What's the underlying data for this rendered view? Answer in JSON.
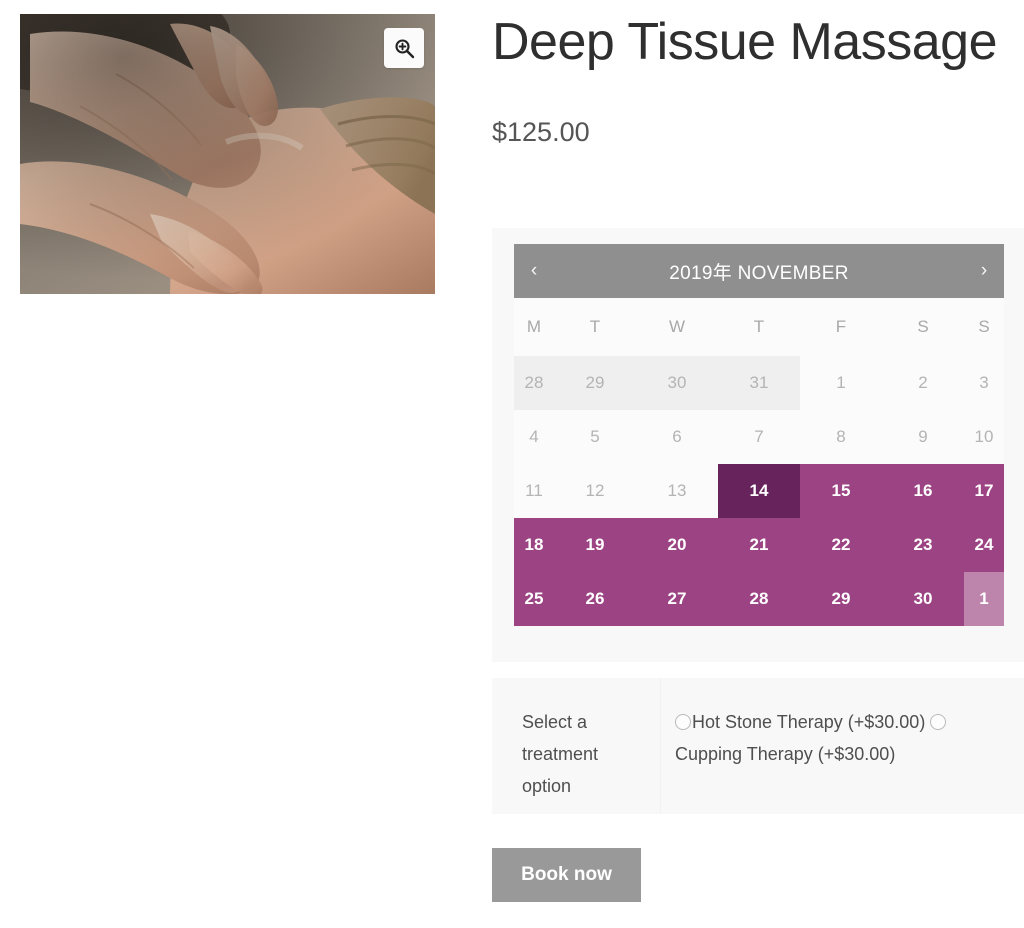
{
  "product": {
    "title": "Deep Tissue Massage",
    "price": "$125.00",
    "image_alt": "massage-therapy-hands-on-shoulder",
    "zoom_icon": "zoom-in-icon"
  },
  "calendar": {
    "prev_label": "‹",
    "next_label": "›",
    "title": "2019年 NOVEMBER",
    "weekdays": [
      "M",
      "T",
      "W",
      "T",
      "F",
      "S",
      "S"
    ],
    "weeks": [
      [
        {
          "day": "28",
          "state": "other-month"
        },
        {
          "day": "29",
          "state": "other-month"
        },
        {
          "day": "30",
          "state": "other-month"
        },
        {
          "day": "31",
          "state": "other-month"
        },
        {
          "day": "1",
          "state": "unavailable"
        },
        {
          "day": "2",
          "state": "unavailable"
        },
        {
          "day": "3",
          "state": "unavailable"
        }
      ],
      [
        {
          "day": "4",
          "state": "unavailable"
        },
        {
          "day": "5",
          "state": "unavailable"
        },
        {
          "day": "6",
          "state": "unavailable"
        },
        {
          "day": "7",
          "state": "unavailable"
        },
        {
          "day": "8",
          "state": "unavailable"
        },
        {
          "day": "9",
          "state": "unavailable"
        },
        {
          "day": "10",
          "state": "unavailable"
        }
      ],
      [
        {
          "day": "11",
          "state": "unavailable"
        },
        {
          "day": "12",
          "state": "unavailable"
        },
        {
          "day": "13",
          "state": "unavailable"
        },
        {
          "day": "14",
          "state": "selected"
        },
        {
          "day": "15",
          "state": "available"
        },
        {
          "day": "16",
          "state": "available"
        },
        {
          "day": "17",
          "state": "available"
        }
      ],
      [
        {
          "day": "18",
          "state": "available"
        },
        {
          "day": "19",
          "state": "available"
        },
        {
          "day": "20",
          "state": "available"
        },
        {
          "day": "21",
          "state": "available"
        },
        {
          "day": "22",
          "state": "available"
        },
        {
          "day": "23",
          "state": "available"
        },
        {
          "day": "24",
          "state": "available"
        }
      ],
      [
        {
          "day": "25",
          "state": "available"
        },
        {
          "day": "26",
          "state": "available"
        },
        {
          "day": "27",
          "state": "available"
        },
        {
          "day": "28",
          "state": "available"
        },
        {
          "day": "29",
          "state": "available"
        },
        {
          "day": "30",
          "state": "available"
        },
        {
          "day": "1",
          "state": "next-month-available"
        }
      ]
    ],
    "colors": {
      "header_bar": "#8f8f8f",
      "available": "#9c4384",
      "selected": "#67245c",
      "next_month_available": "#bd85ab",
      "other_month": "#efefef",
      "panel_background": "#f8f8f8"
    }
  },
  "options": {
    "label": "Select a treatment option",
    "items": [
      {
        "label": "Hot Stone Therapy (+$30.00)",
        "selected": false
      },
      {
        "label": "Cupping Therapy (+$30.00)",
        "selected": false
      }
    ]
  },
  "actions": {
    "book_label": "Book now",
    "book_color": "#999999"
  }
}
